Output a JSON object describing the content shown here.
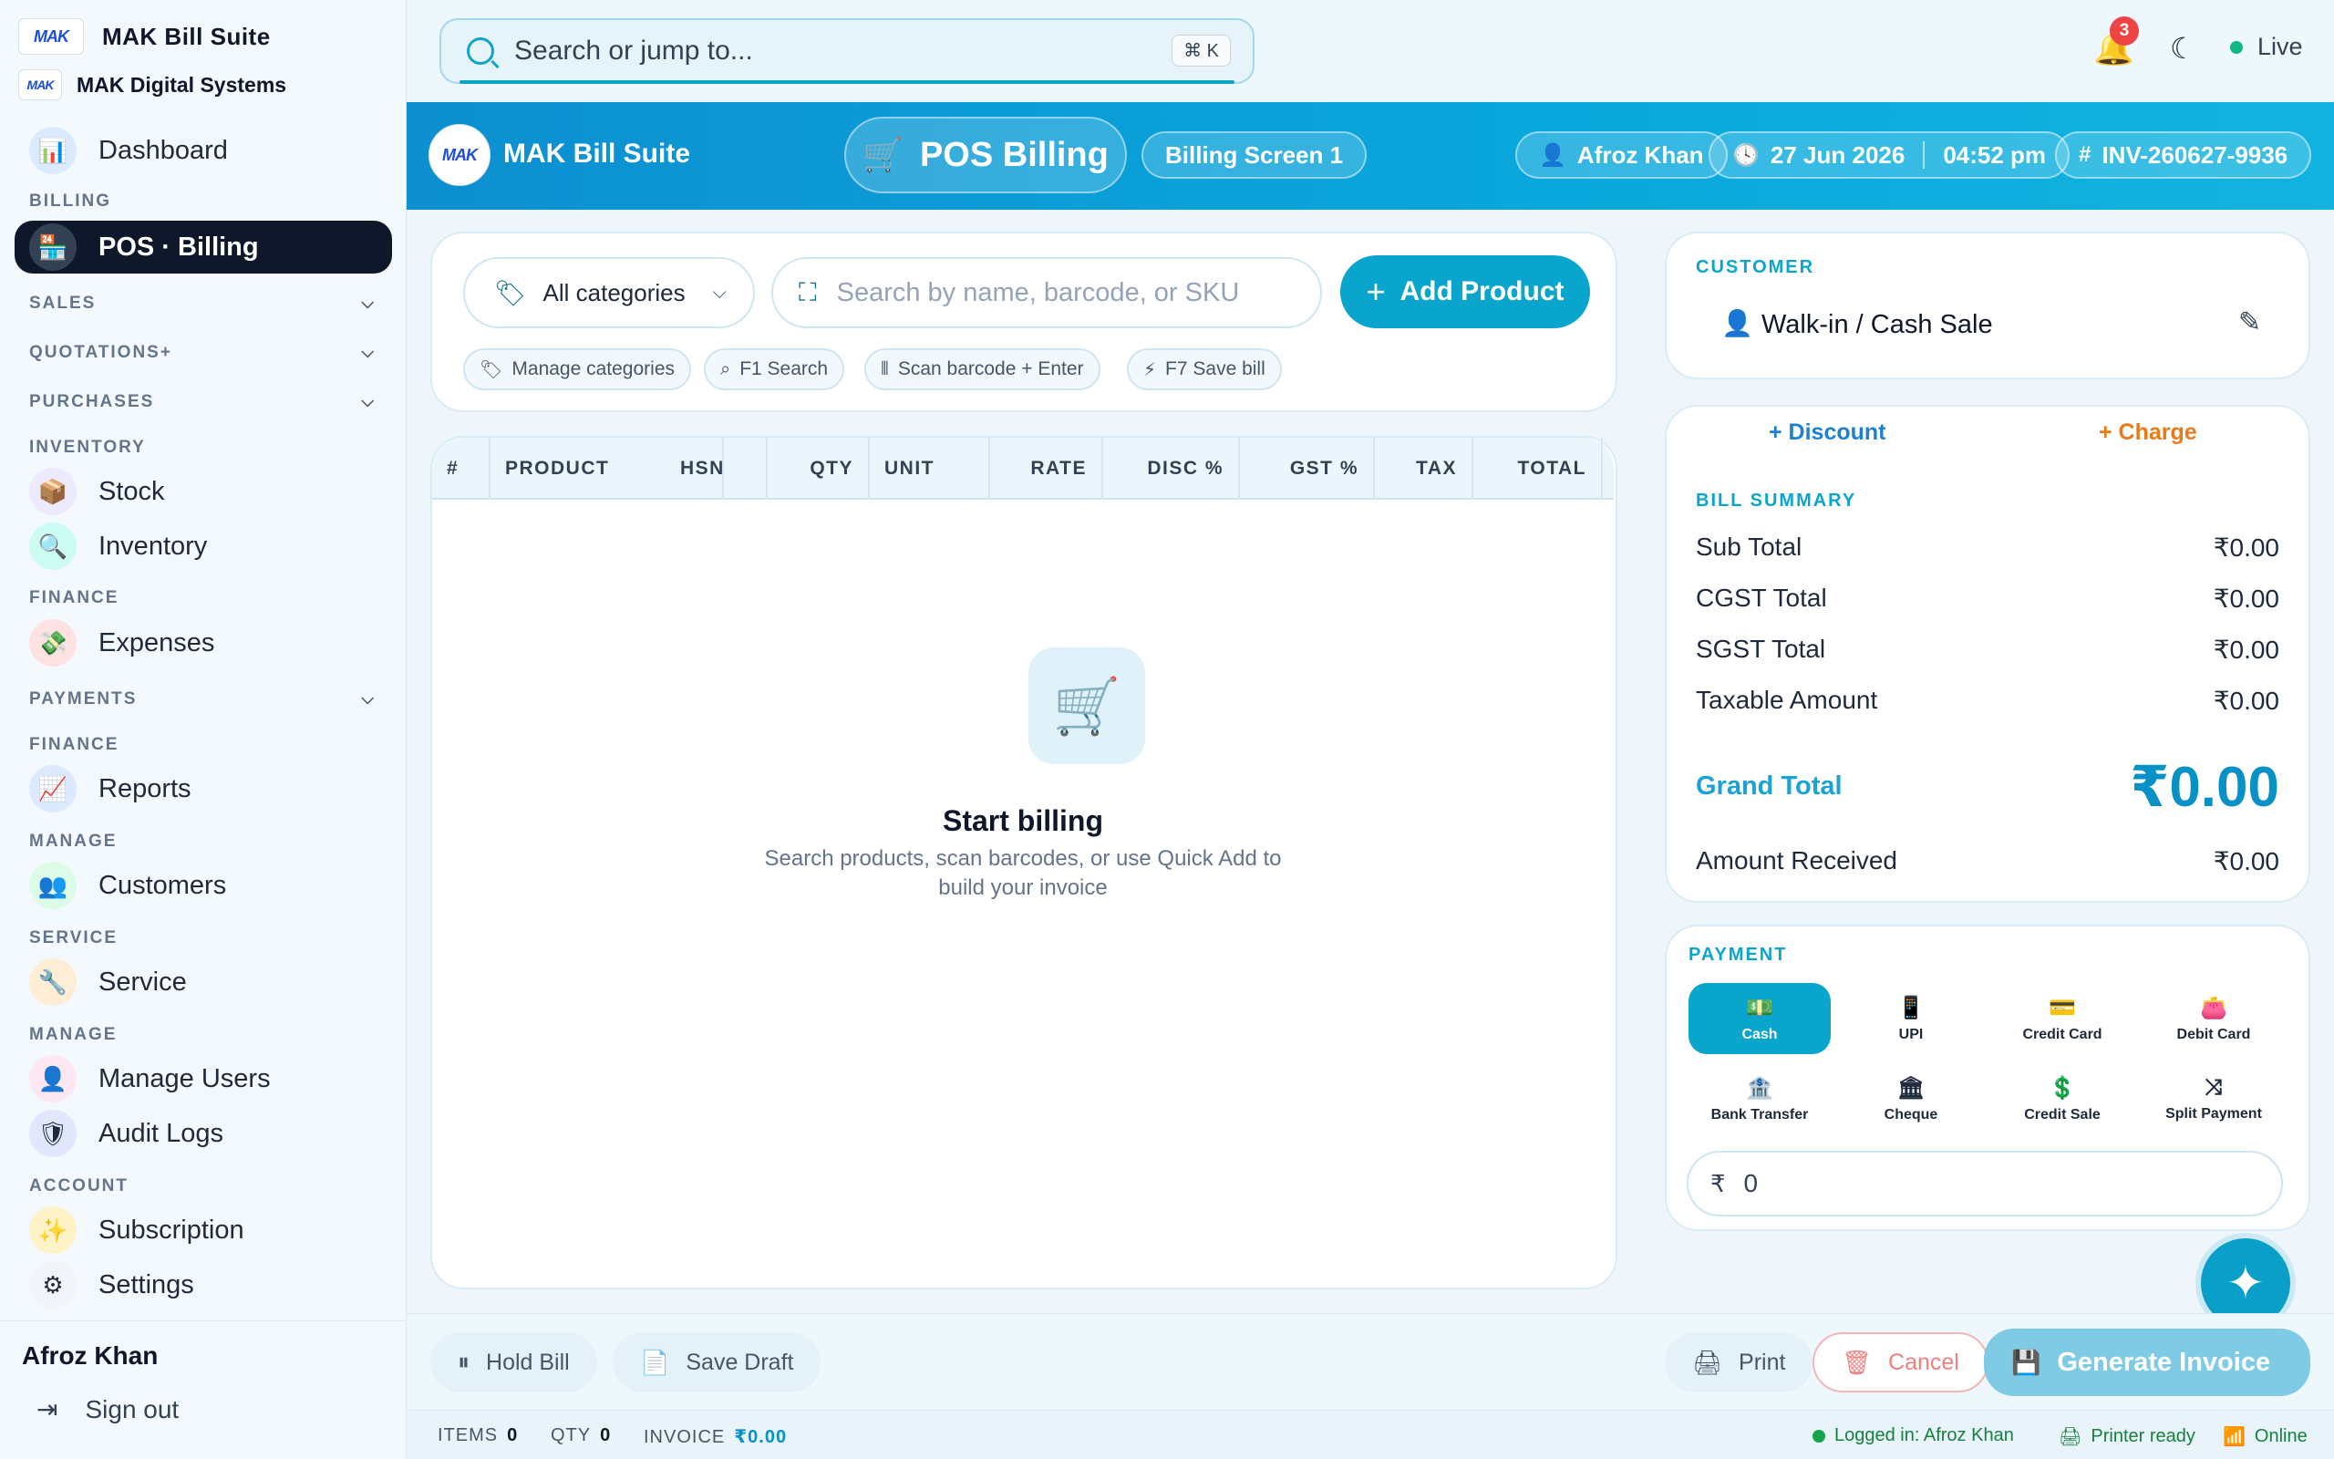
{
  "sidebar": {
    "brand_title": "MAK Bill Suite",
    "logo_text": "MAK",
    "org_name": "MAK Digital Systems",
    "dashboard": "Dashboard",
    "sec_billing": "BILLING",
    "pos_billing": "POS · Billing",
    "sec_sales": "SALES",
    "sec_quotations": "QUOTATIONS+",
    "sec_purchases": "PURCHASES",
    "sec_inventory": "INVENTORY",
    "stock": "Stock",
    "inventory": "Inventory",
    "sec_finance": "FINANCE",
    "expenses": "Expenses",
    "sec_payments": "PAYMENTS",
    "sec_finance2": "FINANCE",
    "reports": "Reports",
    "sec_manage": "MANAGE",
    "customers": "Customers",
    "sec_service": "SERVICE",
    "service": "Service",
    "sec_manage2": "MANAGE",
    "manage_users": "Manage Users",
    "audit_logs": "Audit Logs",
    "sec_account": "ACCOUNT",
    "subscription": "Subscription",
    "settings": "Settings",
    "user_name": "Afroz Khan",
    "sign_out": "Sign out"
  },
  "topbar": {
    "search_placeholder": "Search or jump to...",
    "shortcut": "⌘ K",
    "notif_count": "3",
    "live_label": "Live"
  },
  "header": {
    "title": "MAK Bill Suite",
    "pos_label": "POS Billing",
    "screen_label": "Billing Screen 1",
    "user": "Afroz Khan",
    "date": "27 Jun 2026",
    "time": "04:52 pm",
    "invoice_no": "INV-260627-9936"
  },
  "products": {
    "category_select": "All categories",
    "search_placeholder": "Search by name, barcode, or SKU",
    "add_product": "Add Product",
    "chips": [
      "Manage categories",
      "F1 Search",
      "Scan barcode + Enter",
      "F7 Save bill"
    ]
  },
  "table": {
    "columns": [
      "#",
      "PRODUCT",
      "HSN",
      "QTY",
      "UNIT",
      "RATE",
      "DISC %",
      "GST %",
      "TAX",
      "TOTAL"
    ],
    "empty_title": "Start billing",
    "empty_desc": "Search products, scan barcodes, or use Quick Add to build your invoice"
  },
  "customer": {
    "caption": "CUSTOMER",
    "name": "Walk-in / Cash Sale"
  },
  "summary": {
    "discount": "+ Discount",
    "charge": "+ Charge",
    "caption": "BILL SUMMARY",
    "sub_total_label": "Sub Total",
    "sub_total": "₹0.00",
    "cgst_label": "CGST Total",
    "cgst": "₹0.00",
    "sgst_label": "SGST Total",
    "sgst": "₹0.00",
    "taxable_label": "Taxable Amount",
    "taxable": "₹0.00",
    "grand_label": "Grand Total",
    "grand": "₹0.00",
    "received_label": "Amount Received",
    "received": "₹0.00"
  },
  "payment": {
    "caption": "PAYMENT",
    "methods": [
      "Cash",
      "UPI",
      "Credit Card",
      "Debit Card",
      "Bank Transfer",
      "Cheque",
      "Credit Sale",
      "Split Payment"
    ],
    "selected": "Cash",
    "currency": "₹",
    "amount": "0"
  },
  "footer": {
    "hold": "Hold Bill",
    "save_draft": "Save Draft",
    "print": "Print",
    "cancel": "Cancel",
    "generate": "Generate Invoice"
  },
  "status": {
    "items_label": "ITEMS",
    "items": "0",
    "qty_label": "QTY",
    "qty": "0",
    "invoice_label": "INVOICE",
    "invoice": "₹0.00",
    "logged_in": "Logged in: Afroz Khan",
    "printer": "Printer ready",
    "online": "Online"
  },
  "colors": {
    "accent": "#0aa5cc",
    "active_nav": "#0f172a",
    "charge": "#ea7a18",
    "danger": "#ef4444"
  }
}
